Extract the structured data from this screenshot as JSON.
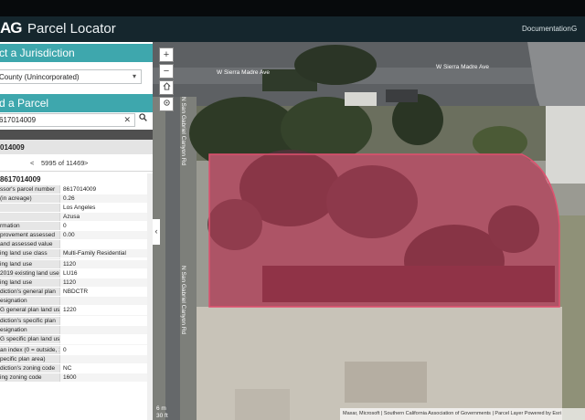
{
  "header": {
    "logo": "AG",
    "title": "Parcel Locator",
    "documentation": "Documentation",
    "extra_link": "G"
  },
  "jurisdiction": {
    "heading": "ct a Jurisdiction",
    "selected": "County (Unincorporated)"
  },
  "parcel_search": {
    "heading": "d a Parcel",
    "value": "617014009"
  },
  "result": {
    "label": "014009"
  },
  "pager": {
    "prev": "<",
    "count": "5995 of 11469",
    "next": ">"
  },
  "details": {
    "parcel_id": "8617014009",
    "rows": [
      {
        "key": "ssor's parcel number",
        "value": "8617014009"
      },
      {
        "key": "(in acreage)",
        "value": "0.26"
      },
      {
        "key": "",
        "value": "Los Angeles"
      },
      {
        "key": "",
        "value": "Azusa"
      },
      {
        "key": "rmation",
        "value": "0"
      },
      {
        "key": "provement assessed",
        "value": "0.00"
      },
      {
        "key": "and assessed value",
        "value": ""
      },
      {
        "key": "ing land use class",
        "value": "Multi-Family Residential"
      },
      {
        "key": "",
        "value": ""
      },
      {
        "key": "ing land use",
        "value": "1120"
      },
      {
        "key": "2019 existing land use",
        "value": "LU16"
      },
      {
        "key": "ing land use",
        "value": "1120"
      },
      {
        "key": "diction's general plan",
        "value": "NBDCTR"
      },
      {
        "key": "esignation",
        "value": ""
      },
      {
        "key": "G general plan land use",
        "value": "1220"
      },
      {
        "key": "",
        "value": ""
      },
      {
        "key": "diction's specific plan",
        "value": ""
      },
      {
        "key": "esignation",
        "value": ""
      },
      {
        "key": "G specific plan land use",
        "value": ""
      },
      {
        "key": "",
        "value": ""
      },
      {
        "key": "an index (0 = outside, 1",
        "value": "0"
      },
      {
        "key": "pecific plan area)",
        "value": ""
      },
      {
        "key": "diction's zoning code",
        "value": "NC"
      },
      {
        "key": "ing zoning code",
        "value": "1600"
      }
    ]
  },
  "map": {
    "zoom_in": "+",
    "zoom_out": "−",
    "streets": {
      "sierra_madre_1": "W Sierra Madre Ave",
      "sierra_madre_2": "W Sierra Madre Ave",
      "vertical_1": "N San Gabriel Canyon Rd",
      "vertical_2": "N San Gabriel Canyon Rd"
    },
    "scale_m": "6 m",
    "scale_ft": "30 ft",
    "attribution": "Maxar, Microsoft | Southern California Association of Governments | Parcel Layer Powered by Esri",
    "parcel_color": "#d23a5c"
  },
  "collapse_arrow": "‹"
}
